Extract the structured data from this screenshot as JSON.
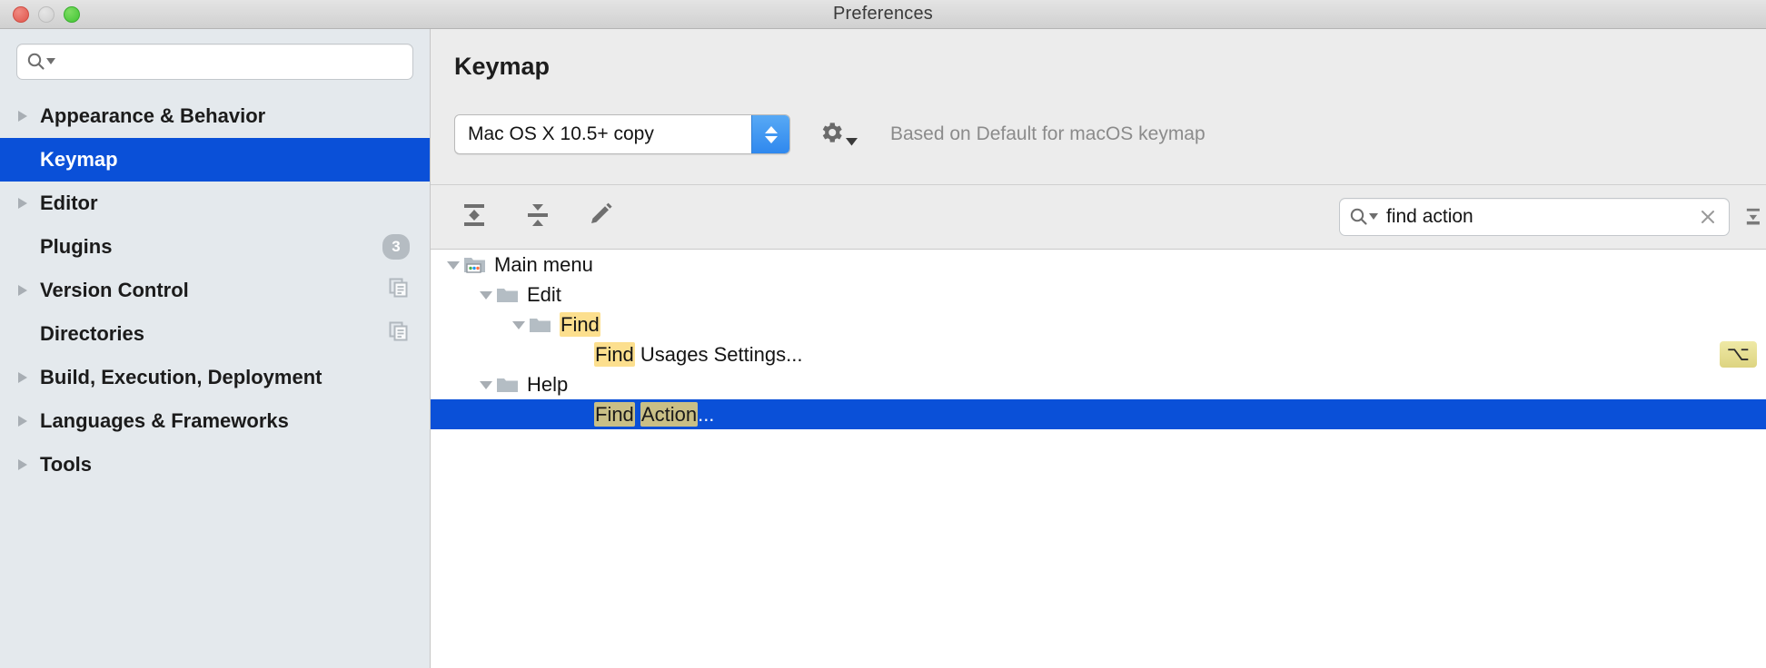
{
  "window": {
    "title": "Preferences",
    "traffic_lights": [
      "close-button",
      "minimize-button",
      "maximize-button"
    ]
  },
  "sidebar": {
    "search": {
      "value": "",
      "placeholder": ""
    },
    "items": [
      {
        "label": "Appearance & Behavior",
        "expandable": true,
        "selected": false,
        "badge": null,
        "trailing_icon": null
      },
      {
        "label": "Keymap",
        "expandable": false,
        "selected": true,
        "badge": null,
        "trailing_icon": null
      },
      {
        "label": "Editor",
        "expandable": true,
        "selected": false,
        "badge": null,
        "trailing_icon": null
      },
      {
        "label": "Plugins",
        "expandable": false,
        "selected": false,
        "badge": "3",
        "trailing_icon": null
      },
      {
        "label": "Version Control",
        "expandable": true,
        "selected": false,
        "badge": null,
        "trailing_icon": "copy-icon"
      },
      {
        "label": "Directories",
        "expandable": false,
        "selected": false,
        "badge": null,
        "trailing_icon": "copy-icon"
      },
      {
        "label": "Build, Execution, Deployment",
        "expandable": true,
        "selected": false,
        "badge": null,
        "trailing_icon": null
      },
      {
        "label": "Languages & Frameworks",
        "expandable": true,
        "selected": false,
        "badge": null,
        "trailing_icon": null
      },
      {
        "label": "Tools",
        "expandable": true,
        "selected": false,
        "badge": null,
        "trailing_icon": null
      }
    ]
  },
  "main": {
    "page_title": "Keymap",
    "keymap_select": {
      "value": "Mac OS X 10.5+ copy"
    },
    "gear_button_label": "gear-icon",
    "based_on": "Based on Default for macOS keymap",
    "toolbar": {
      "expand_all_label": "expand-all-icon",
      "collapse_all_label": "collapse-all-icon",
      "edit_label": "edit-pencil-icon"
    },
    "find": {
      "value": "find action",
      "placeholder": ""
    },
    "tree": [
      {
        "label": "Main menu",
        "indent": 0,
        "twisty": "expanded",
        "icon": "main-menu-folder-icon",
        "selected": false,
        "segments": [
          {
            "text": "Main menu",
            "highlight": false
          }
        ],
        "shortcut": null
      },
      {
        "label": "Edit",
        "indent": 1,
        "twisty": "expanded",
        "icon": "folder-icon",
        "selected": false,
        "segments": [
          {
            "text": "Edit",
            "highlight": false
          }
        ],
        "shortcut": null
      },
      {
        "label": "Find",
        "indent": 2,
        "twisty": "expanded",
        "icon": "folder-icon",
        "selected": false,
        "segments": [
          {
            "text": "Find",
            "highlight": true
          }
        ],
        "shortcut": null
      },
      {
        "label": "Find Usages Settings...",
        "indent": 4,
        "twisty": "none",
        "icon": "none",
        "selected": false,
        "segments": [
          {
            "text": "Find",
            "highlight": true
          },
          {
            "text": " Usages Settings...",
            "highlight": false
          }
        ],
        "shortcut": "⌥"
      },
      {
        "label": "Help",
        "indent": 1,
        "twisty": "expanded",
        "icon": "folder-icon",
        "selected": false,
        "segments": [
          {
            "text": "Help",
            "highlight": false
          }
        ],
        "shortcut": null
      },
      {
        "label": "Find Action...",
        "indent": 4,
        "twisty": "none",
        "icon": "none",
        "selected": true,
        "segments": [
          {
            "text": "Find",
            "highlight": true
          },
          {
            "text": " ",
            "highlight": false
          },
          {
            "text": "Action",
            "highlight": true
          },
          {
            "text": "...",
            "highlight": false
          }
        ],
        "shortcut": null
      }
    ]
  },
  "colors": {
    "selection_blue": "#0a50d8",
    "sidebar_bg": "#e4e9ed",
    "main_bg": "#ececec",
    "tree_bg": "#ffffff",
    "highlight_yellow": "#fcdf8e",
    "highlight_selected": "#c9bf86",
    "badge_gray": "#b5bcc2",
    "muted_text": "#8b8b8b"
  }
}
